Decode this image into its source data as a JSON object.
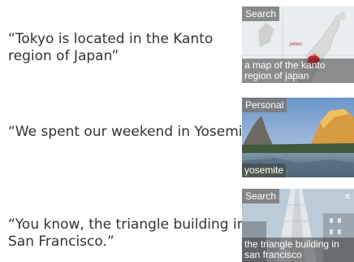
{
  "rows": [
    {
      "quote": "“Tokyo is located in the Kanto\nregion of Japan”",
      "card": {
        "badge": "Search",
        "caption": "a map of the kanto\nregion of japan",
        "has_close": true,
        "map_label": "JAPAN"
      }
    },
    {
      "quote": "“We spent our weekend in Yosemite”",
      "card": {
        "badge": "Personal",
        "caption": "yosemite",
        "has_close": false
      }
    },
    {
      "quote": "“You know, the triangle building in\n  San Francisco.”",
      "card": {
        "badge": "Search",
        "caption": "the triangle building in\nsan francisco",
        "has_close": true
      }
    }
  ],
  "icons": {
    "close": "×"
  },
  "colors": {
    "quote_text": "#333333",
    "badge_bg": "#7a7a7a",
    "map_highlight": "#cc2222"
  }
}
